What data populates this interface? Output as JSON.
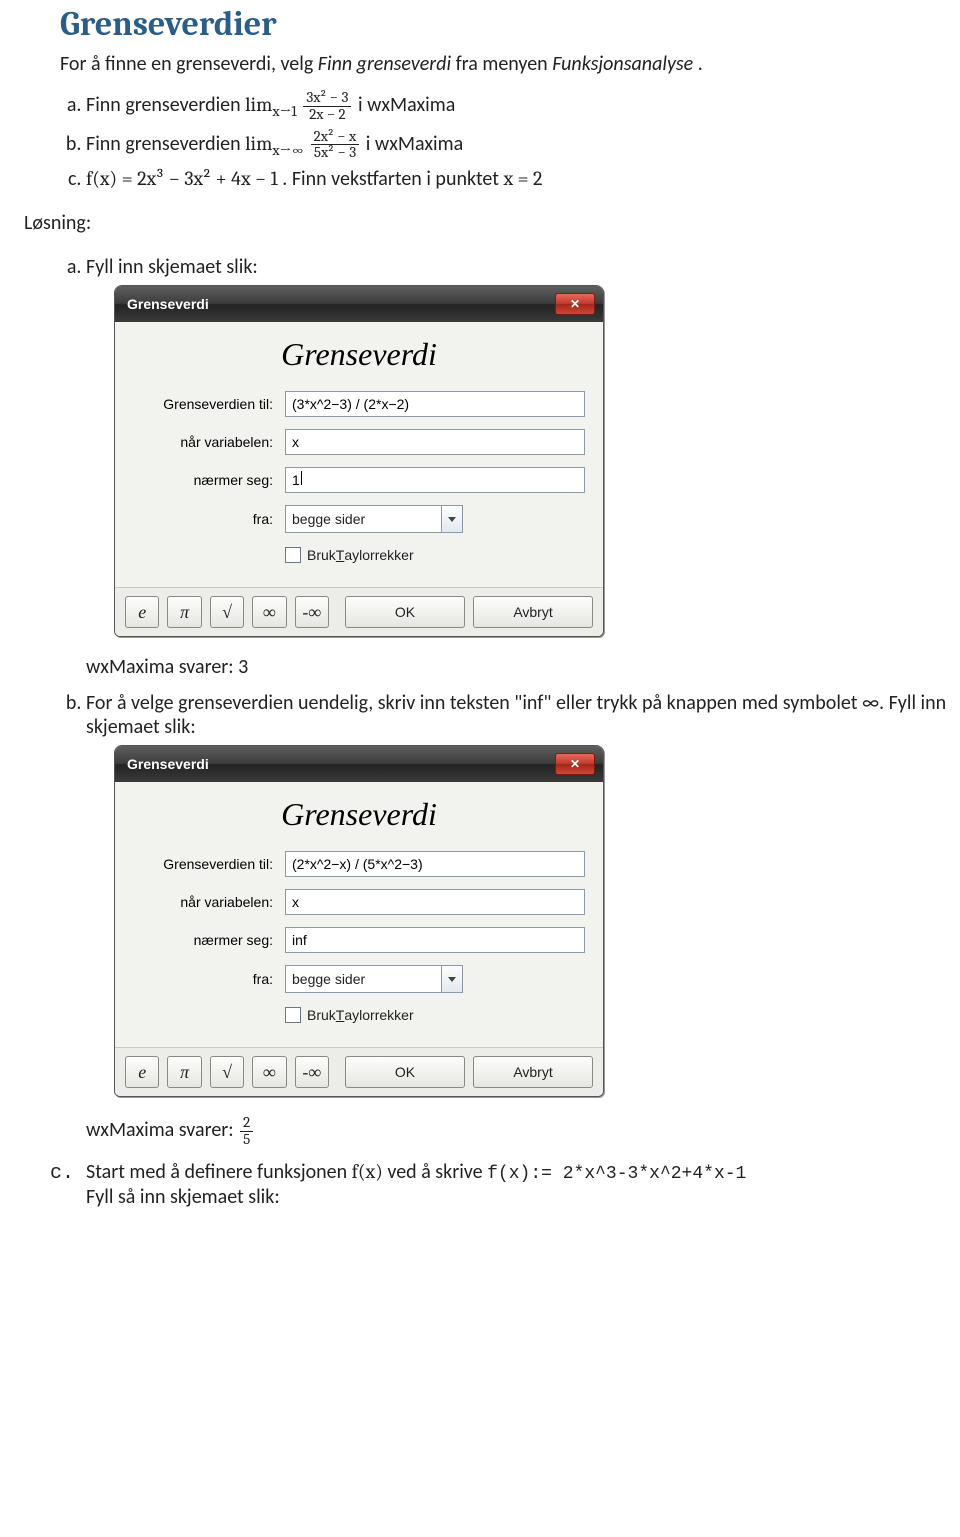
{
  "page": {
    "title": "Grenseverdier",
    "intro_prefix": "For å finne en grenseverdi, velg ",
    "intro_italic": "Finn grenseverdi",
    "intro_mid": " fra menyen ",
    "intro_italic2": "Funksjonsanalyse",
    "intro_suffix": "."
  },
  "tasks": {
    "a": {
      "pre": "Finn grenseverdien ",
      "lim": "lim",
      "sub": "x→1",
      "num": "3x² − 3",
      "den": "2x − 2",
      "post": " i wxMaxima"
    },
    "b": {
      "pre": "Finn grenseverdien ",
      "lim": "lim",
      "sub": "x→∞",
      "num": "2x² − x",
      "den": "5x² − 3",
      "post": " i wxMaxima"
    },
    "c": {
      "fx": "f(x) = 2x³ − 3x² + 4x − 1",
      "after": ". Finn vekstfarten i punktet ",
      "cond": "x = 2"
    }
  },
  "losning_label": "Løsning:",
  "sol_a_intro": "Fyll inn skjemaet slik:",
  "dialog1": {
    "title": "Grenseverdi",
    "headline": "Grenseverdi",
    "label_expr": "Grenseverdien til:",
    "expr": "(3*x^2−3) / (2*x−2)",
    "label_var": "når variabelen:",
    "var": "x",
    "label_to": "nærmer seg:",
    "to": "1",
    "label_from": "fra:",
    "from": "begge sider",
    "taylor_pre": "Bruk ",
    "taylor_ul": "T",
    "taylor_post": "aylorrekker",
    "btns": {
      "e": "e",
      "pi": "π",
      "sqrt": "√",
      "inf": "∞",
      "ninf": "-∞",
      "ok": "OK",
      "cancel": "Avbryt"
    }
  },
  "answer_a": {
    "pre": "wxMaxima svarer:  ",
    "val": "3"
  },
  "sol_b_text": "For å velge grenseverdien uendelig, skriv inn teksten \"inf\" eller trykk på knappen med symbolet ∞. Fyll inn skjemaet slik:",
  "dialog2": {
    "title": "Grenseverdi",
    "headline": "Grenseverdi",
    "label_expr": "Grenseverdien til:",
    "expr": "(2*x^2−x) / (5*x^2−3)",
    "label_var": "når variabelen:",
    "var": "x",
    "label_to": "nærmer seg:",
    "to": "inf",
    "label_from": "fra:",
    "from": "begge sider",
    "taylor_pre": "Bruk ",
    "taylor_ul": "T",
    "taylor_post": "aylorrekker",
    "btns": {
      "e": "e",
      "pi": "π",
      "sqrt": "√",
      "inf": "∞",
      "ninf": "-∞",
      "ok": "OK",
      "cancel": "Avbryt"
    }
  },
  "answer_b": {
    "pre": "wxMaxima svarer: ",
    "num": "2",
    "den": "5"
  },
  "sol_c": {
    "pre": "Start med å definere funksjonen ",
    "fx": "f(x)",
    "mid": " ved å skrive ",
    "code": "f(x):= 2*x^3-3*x^2+4*x-1",
    "post": "Fyll så inn skjemaet slik:"
  }
}
